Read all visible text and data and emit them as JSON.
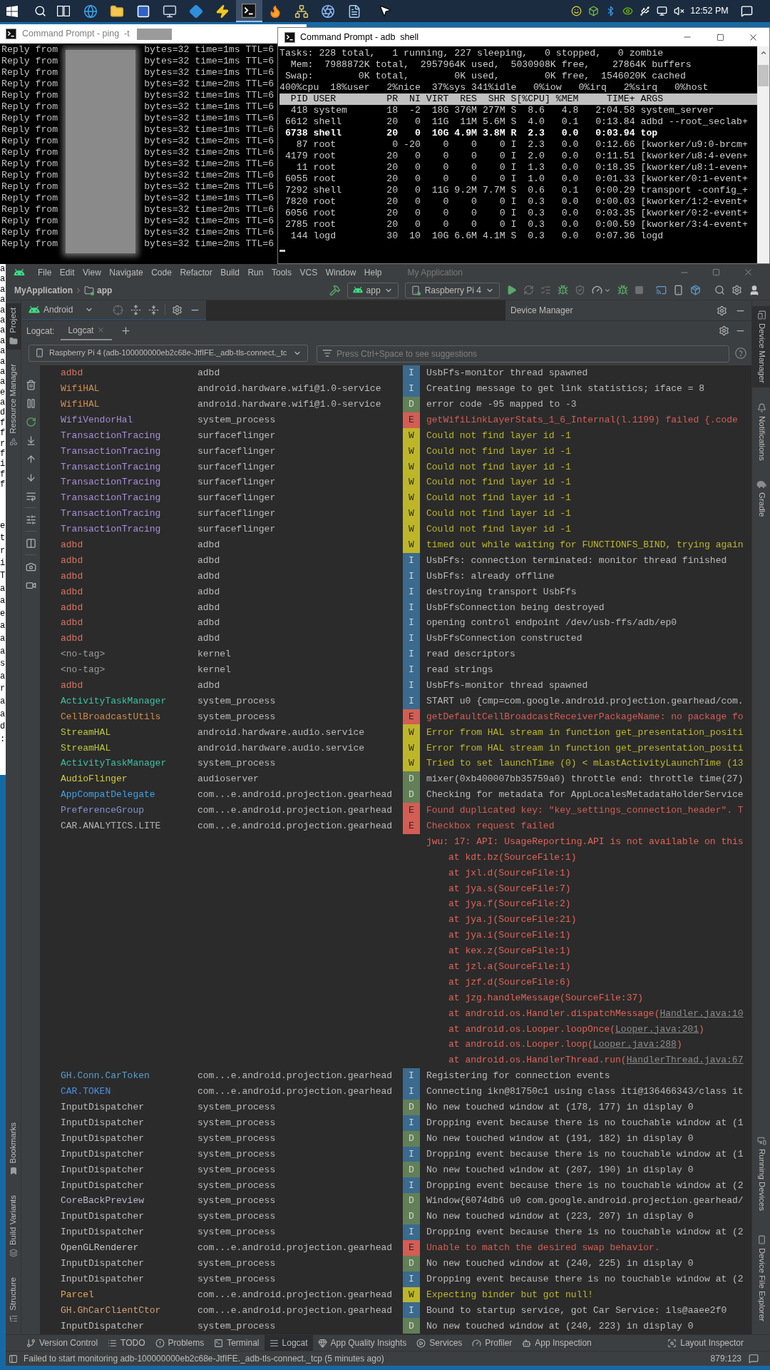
{
  "taskbar": {
    "apps": [
      {
        "selected": false
      },
      {
        "selected": false
      },
      {
        "selected": false
      },
      {
        "selected": false
      },
      {
        "selected": false
      },
      {
        "selected": false
      },
      {
        "selected": true
      },
      {
        "selected": false
      },
      {
        "selected": false
      },
      {
        "selected": false
      },
      {
        "selected": false
      }
    ],
    "clock": "12:52 PM"
  },
  "background_window": {
    "upper_lines": [
      "a",
      "a",
      "a",
      "a",
      "a",
      "a",
      "a",
      "a",
      "a",
      "a",
      "a",
      "a",
      "e",
      "a",
      "d",
      "f",
      "f",
      "r",
      "f",
      "i",
      "f",
      "f"
    ],
    "lower_lines": [
      "e",
      "t",
      "r",
      "i",
      "T",
      "a",
      "a",
      "e",
      "a",
      "a",
      "a",
      "s",
      "a",
      "r",
      "a",
      "a",
      "d",
      ":"
    ]
  },
  "ping_window": {
    "title": "Command Prompt - ping  -t",
    "lines": [
      {
        "start": "Reply from",
        "reply": "bytes=32 time=1ms TTL=6"
      },
      {
        "start": "Reply from",
        "reply": "bytes=32 time=1ms TTL=6"
      },
      {
        "start": "Reply from",
        "reply": "bytes=32 time=1ms TTL=6"
      },
      {
        "start": "Reply from",
        "reply": "bytes=32 time=2ms TTL=6"
      },
      {
        "start": "Reply from",
        "reply": "bytes=32 time=1ms TTL=6"
      },
      {
        "start": "Reply from",
        "reply": "bytes=32 time=1ms TTL=6"
      },
      {
        "start": "Reply from",
        "reply": "bytes=32 time=1ms TTL=6"
      },
      {
        "start": "Reply from",
        "reply": "bytes=32 time=1ms TTL=6"
      },
      {
        "start": "Reply from",
        "reply": "bytes=32 time=2ms TTL=6"
      },
      {
        "start": "Reply from",
        "reply": "bytes=32 time=2ms TTL=6"
      },
      {
        "start": "Reply from",
        "reply": "bytes=32 time=2ms TTL=6"
      },
      {
        "start": "Reply from",
        "reply": "bytes=32 time=2ms TTL=6"
      },
      {
        "start": "Reply from",
        "reply": "bytes=32 time=2ms TTL=6"
      },
      {
        "start": "Reply from",
        "reply": "bytes=32 time=1ms TTL=6"
      },
      {
        "start": "Reply from",
        "reply": "bytes=32 time=2ms TTL=6"
      },
      {
        "start": "Reply from",
        "reply": "bytes=32 time=2ms TTL=6"
      },
      {
        "start": "Reply from",
        "reply": "bytes=32 time=2ms TTL=6"
      },
      {
        "start": "Reply from",
        "reply": "bytes=32 time=2ms TTL=6"
      }
    ]
  },
  "adb_window": {
    "title": "Command Prompt - adb  shell",
    "summary_lines": [
      "Tasks: 228 total,   1 running, 227 sleeping,   0 stopped,   0 zombie",
      "  Mem:  7988872K total,  2957964K used,  5030908K free,    27864K buffers",
      " Swap:        0K total,        0K used,        0K free,  1546020K cached",
      "400%cpu  18%user   2%nice  37%sys 341%idle   0%iow   0%irq   2%sirq   0%host"
    ],
    "table_header": "  PID USER         PR  NI VIRT  RES  SHR S[%CPU] %MEM     TIME+ ARGS",
    "process_rows": [
      {
        "text": "  418 system       18  -2  18G 376M 277M S  8.6   4.8   2:04.58 system_server",
        "bold": false
      },
      {
        "text": " 6612 shell        20   0  11G  11M 5.6M S  4.0   0.1   0:13.84 adbd --root_seclab+",
        "bold": false
      },
      {
        "text": " 6738 shell        20   0  10G 4.9M 3.8M R  2.3   0.0   0:03.94 top",
        "bold": true
      },
      {
        "text": "   87 root          0 -20    0    0    0 I  2.3   0.0   0:12.66 [kworker/u9:0-brcm+",
        "bold": false
      },
      {
        "text": " 4179 root         20   0    0    0    0 I  2.0   0.0   0:11.51 [kworker/u8:4-even+",
        "bold": false
      },
      {
        "text": "   11 root         20   0    0    0    0 I  1.3   0.0   0:18.35 [kworker/u8:1-even+",
        "bold": false
      },
      {
        "text": " 6055 root         20   0    0    0    0 I  1.0   0.0   0:01.33 [kworker/0:1-event+",
        "bold": false
      },
      {
        "text": " 7292 shell        20   0  11G 9.2M 7.7M S  0.6   0.1   0:00.29 transport -config_+",
        "bold": false
      },
      {
        "text": " 7820 root         20   0    0    0    0 I  0.3   0.0   0:00.03 [kworker/1:2-event+",
        "bold": false
      },
      {
        "text": " 6056 root         20   0    0    0    0 I  0.3   0.0   0:03.35 [kworker/0:2-event+",
        "bold": false
      },
      {
        "text": " 2785 root         20   0    0    0    0 I  0.3   0.0   0:00.59 [kworker/3:4-event+",
        "bold": false
      },
      {
        "text": "  144 logd         30  10  10G 6.6M 4.1M S  0.3   0.0   0:07.36 logd",
        "bold": false
      }
    ]
  },
  "android_studio": {
    "menu": [
      "File",
      "Edit",
      "View",
      "Navigate",
      "Code",
      "Refactor",
      "Build",
      "Run",
      "Tools",
      "VCS",
      "Window",
      "Help"
    ],
    "title": "My Application",
    "breadcrumb": [
      "MyApplication",
      "app"
    ],
    "run_configuration": "app",
    "target_device": "Raspberry Pi 4",
    "left_tool_tabs": {
      "top": [
        {
          "label": "Project",
          "selected": true
        },
        {
          "label": "Resource Manager",
          "selected": false
        }
      ],
      "bottom": [
        {
          "label": "Bookmarks",
          "selected": false
        },
        {
          "label": "Build Variants",
          "selected": false
        },
        {
          "label": "Structure",
          "selected": false
        }
      ]
    },
    "right_tool_tabs": {
      "top": [
        {
          "label": "Device Manager",
          "selected": true
        },
        {
          "label": "Notifications",
          "selected": false
        },
        {
          "label": "Gradle",
          "selected": false
        }
      ],
      "bottom": [
        {
          "label": "Running Devices",
          "selected": false
        },
        {
          "label": "Device File Explorer",
          "selected": false
        }
      ]
    },
    "project_panel": {
      "view": "Android"
    },
    "device_manager_panel": {
      "title": "Device Manager"
    },
    "logcat": {
      "label": "Logcat:",
      "tabs": [
        {
          "label": "Logcat",
          "selected": true
        }
      ],
      "device": "Raspberry Pi 4 (adb-100000000eb2c68e-JtfIFE._adb-tls-connect._tc",
      "filter": {
        "placeholder": "Press Ctrl+Space to see suggestions"
      },
      "rows": [
        {
          "kind": "entry",
          "tag": {
            "text": "adbd",
            "color": "#d9725f"
          },
          "process": "adbd",
          "level": {
            "text": "I",
            "color": "#3a6a8e"
          },
          "message": "UsbFfs-monitor thread spawned"
        },
        {
          "kind": "entry",
          "tag": {
            "text": "WifiHAL",
            "color": "#d48d4e"
          },
          "process": "android.hardware.wifi@1.0-service",
          "level": {
            "text": "I",
            "color": "#3a6a8e"
          },
          "message": "Creating message to get link statistics; iface = 8"
        },
        {
          "kind": "entry",
          "tag": {
            "text": "WifiHAL",
            "color": "#d48d4e"
          },
          "process": "android.hardware.wifi@1.0-service",
          "level": {
            "text": "D",
            "color": "#627f57"
          },
          "message": "error code -95 mapped to -3"
        },
        {
          "kind": "entry",
          "tag": {
            "text": "WifiVendorHal",
            "color": "#a08ed4"
          },
          "process": "system_process",
          "level": {
            "text": "E",
            "color": "#d45d54"
          },
          "message": "getWifiLinkLayerStats_1_6_Internal(l.1199) failed {.code"
        },
        {
          "kind": "entry",
          "tag": {
            "text": "TransactionTracing",
            "color": "#a78fd9"
          },
          "process": "surfaceflinger",
          "level": {
            "text": "W",
            "color": "#bdb629"
          },
          "message": "Could not find layer id -1"
        },
        {
          "kind": "entry",
          "tag": {
            "text": "TransactionTracing",
            "color": "#a78fd9"
          },
          "process": "surfaceflinger",
          "level": {
            "text": "W",
            "color": "#bdb629"
          },
          "message": "Could not find layer id -1"
        },
        {
          "kind": "entry",
          "tag": {
            "text": "TransactionTracing",
            "color": "#a78fd9"
          },
          "process": "surfaceflinger",
          "level": {
            "text": "W",
            "color": "#bdb629"
          },
          "message": "Could not find layer id -1"
        },
        {
          "kind": "entry",
          "tag": {
            "text": "TransactionTracing",
            "color": "#a78fd9"
          },
          "process": "surfaceflinger",
          "level": {
            "text": "W",
            "color": "#bdb629"
          },
          "message": "Could not find layer id -1"
        },
        {
          "kind": "entry",
          "tag": {
            "text": "TransactionTracing",
            "color": "#a78fd9"
          },
          "process": "surfaceflinger",
          "level": {
            "text": "W",
            "color": "#bdb629"
          },
          "message": "Could not find layer id -1"
        },
        {
          "kind": "entry",
          "tag": {
            "text": "TransactionTracing",
            "color": "#a78fd9"
          },
          "process": "surfaceflinger",
          "level": {
            "text": "W",
            "color": "#bdb629"
          },
          "message": "Could not find layer id -1"
        },
        {
          "kind": "entry",
          "tag": {
            "text": "TransactionTracing",
            "color": "#a78fd9"
          },
          "process": "surfaceflinger",
          "level": {
            "text": "W",
            "color": "#bdb629"
          },
          "message": "Could not find layer id -1"
        },
        {
          "kind": "entry",
          "tag": {
            "text": "adbd",
            "color": "#d9725f"
          },
          "process": "adbd",
          "level": {
            "text": "W",
            "color": "#bdb629"
          },
          "message": "timed out while waiting for FUNCTIONFS_BIND, trying again"
        },
        {
          "kind": "entry",
          "tag": {
            "text": "adbd",
            "color": "#d9725f"
          },
          "process": "adbd",
          "level": {
            "text": "I",
            "color": "#3a6a8e"
          },
          "message": "UsbFfs: connection terminated: monitor thread finished"
        },
        {
          "kind": "entry",
          "tag": {
            "text": "adbd",
            "color": "#d9725f"
          },
          "process": "adbd",
          "level": {
            "text": "I",
            "color": "#3a6a8e"
          },
          "message": "UsbFfs: already offline"
        },
        {
          "kind": "entry",
          "tag": {
            "text": "adbd",
            "color": "#d9725f"
          },
          "process": "adbd",
          "level": {
            "text": "I",
            "color": "#3a6a8e"
          },
          "message": "destroying transport UsbFfs"
        },
        {
          "kind": "entry",
          "tag": {
            "text": "adbd",
            "color": "#d9725f"
          },
          "process": "adbd",
          "level": {
            "text": "I",
            "color": "#3a6a8e"
          },
          "message": "UsbFfsConnection being destroyed"
        },
        {
          "kind": "entry",
          "tag": {
            "text": "adbd",
            "color": "#d9725f"
          },
          "process": "adbd",
          "level": {
            "text": "I",
            "color": "#3a6a8e"
          },
          "message": "opening control endpoint /dev/usb-ffs/adb/ep0"
        },
        {
          "kind": "entry",
          "tag": {
            "text": "adbd",
            "color": "#d9725f"
          },
          "process": "adbd",
          "level": {
            "text": "I",
            "color": "#3a6a8e"
          },
          "message": "UsbFfsConnection constructed"
        },
        {
          "kind": "entry",
          "tag": {
            "text": "<no-tag>",
            "color": "#9b9b9b"
          },
          "process": "kernel",
          "level": {
            "text": "I",
            "color": "#3a6a8e"
          },
          "message": "read descriptors"
        },
        {
          "kind": "entry",
          "tag": {
            "text": "<no-tag>",
            "color": "#9b9b9b"
          },
          "process": "kernel",
          "level": {
            "text": "I",
            "color": "#3a6a8e"
          },
          "message": "read strings"
        },
        {
          "kind": "entry",
          "tag": {
            "text": "adbd",
            "color": "#d9725f"
          },
          "process": "adbd",
          "level": {
            "text": "I",
            "color": "#3a6a8e"
          },
          "message": "UsbFfs-monitor thread spawned"
        },
        {
          "kind": "entry",
          "tag": {
            "text": "ActivityTaskManager",
            "color": "#3cc0a4"
          },
          "process": "system_process",
          "level": {
            "text": "I",
            "color": "#3a6a8e"
          },
          "message": "START u0 {cmp=com.google.android.projection.gearhead/com."
        },
        {
          "kind": "entry",
          "tag": {
            "text": "CellBroadcastUtils",
            "color": "#d08c48"
          },
          "process": "system_process",
          "level": {
            "text": "E",
            "color": "#d45d54"
          },
          "message": "getDefaultCellBroadcastReceiverPackageName: no package fo"
        },
        {
          "kind": "entry",
          "tag": {
            "text": "StreamHAL",
            "color": "#b7ca35"
          },
          "process": "android.hardware.audio.service",
          "level": {
            "text": "W",
            "color": "#bdb629"
          },
          "message": "Error from HAL stream in function get_presentation_positi"
        },
        {
          "kind": "entry",
          "tag": {
            "text": "StreamHAL",
            "color": "#b7ca35"
          },
          "process": "android.hardware.audio.service",
          "level": {
            "text": "W",
            "color": "#bdb629"
          },
          "message": "Error from HAL stream in function get_presentation_positi"
        },
        {
          "kind": "entry",
          "tag": {
            "text": "ActivityTaskManager",
            "color": "#3cc0a4"
          },
          "process": "system_process",
          "level": {
            "text": "W",
            "color": "#bdb629"
          },
          "message": "Tried to set launchTime (0) < mLastActivityLaunchTime (13"
        },
        {
          "kind": "entry",
          "tag": {
            "text": "AudioFlinger",
            "color": "#cfcc3e"
          },
          "process": "audioserver",
          "level": {
            "text": "D",
            "color": "#627f57"
          },
          "message": "mixer(0xb400007bb35759a0) throttle end: throttle time(27)"
        },
        {
          "kind": "entry",
          "tag": {
            "text": "AppCompatDelegate",
            "color": "#3fa2ea"
          },
          "process": "com...e.android.projection.gearhead",
          "level": {
            "text": "D",
            "color": "#627f57"
          },
          "message": "Checking for metadata for AppLocalesMetadataHolderService"
        },
        {
          "kind": "entry",
          "tag": {
            "text": "PreferenceGroup",
            "color": "#8592d4"
          },
          "process": "com...e.android.projection.gearhead",
          "level": {
            "text": "E",
            "color": "#d45d54"
          },
          "message": "Found duplicated key: \"key_settings_connection_header\". T"
        },
        {
          "kind": "entry",
          "tag": {
            "text": "CAR.ANALYTICS.LITE",
            "color": "#b3b3b3"
          },
          "process": "com...e.android.projection.gearhead",
          "level": {
            "text": "E",
            "color": "#d45d54"
          },
          "message": "Checkbox request failed"
        },
        {
          "kind": "detail",
          "text": "jwu: 17: API: UsageReporting.API is not available on this"
        },
        {
          "kind": "frame",
          "text": "at kdt.bz(SourceFile:1)"
        },
        {
          "kind": "frame",
          "text": "at jxl.d(SourceFile:1)"
        },
        {
          "kind": "frame",
          "text": "at jya.s(SourceFile:7)"
        },
        {
          "kind": "frame",
          "text": "at jya.f(SourceFile:2)"
        },
        {
          "kind": "frame",
          "text": "at jya.j(SourceFile:21)"
        },
        {
          "kind": "frame",
          "text": "at jya.i(SourceFile:1)"
        },
        {
          "kind": "frame",
          "text": "at kex.z(SourceFile:1)"
        },
        {
          "kind": "frame",
          "text": "at jzl.a(SourceFile:1)"
        },
        {
          "kind": "frame",
          "text": "at jzf.d(SourceFile:6)"
        },
        {
          "kind": "frame",
          "text": "at jzg.handleMessage(SourceFile:37)"
        },
        {
          "kind": "frame",
          "text": "at android.os.Handler.dispatchMessage(",
          "link": "Handler.java:10"
        },
        {
          "kind": "frame",
          "text": "at android.os.Looper.loopOnce(",
          "link": "Looper.java:201",
          "suffix": ")"
        },
        {
          "kind": "frame",
          "text": "at android.os.Looper.loop(",
          "link": "Looper.java:288",
          "suffix": ")"
        },
        {
          "kind": "frame",
          "text": "at android.os.HandlerThread.run(",
          "link": "HandlerThread.java:67"
        },
        {
          "kind": "entry",
          "tag": {
            "text": "GH.Conn.CarToken",
            "color": "#5a9fc9"
          },
          "process": "com...e.android.projection.gearhead",
          "level": {
            "text": "I",
            "color": "#3a6a8e"
          },
          "message": "Registering for connection events"
        },
        {
          "kind": "entry",
          "tag": {
            "text": "CAR.TOKEN",
            "color": "#4b91e3"
          },
          "process": "com...e.android.projection.gearhead",
          "level": {
            "text": "I",
            "color": "#3a6a8e"
          },
          "message": "Connecting ikn@81750c1 using class iti@136466343/class it"
        },
        {
          "kind": "entry",
          "tag": {
            "text": "InputDispatcher",
            "color": "#bcbcbc"
          },
          "process": "system_process",
          "level": {
            "text": "D",
            "color": "#627f57"
          },
          "message": "No new touched window at (178, 177) in display 0"
        },
        {
          "kind": "entry",
          "tag": {
            "text": "InputDispatcher",
            "color": "#bcbcbc"
          },
          "process": "system_process",
          "level": {
            "text": "I",
            "color": "#3a6a8e"
          },
          "message": "Dropping event because there is no touchable window at (1"
        },
        {
          "kind": "entry",
          "tag": {
            "text": "InputDispatcher",
            "color": "#bcbcbc"
          },
          "process": "system_process",
          "level": {
            "text": "D",
            "color": "#627f57"
          },
          "message": "No new touched window at (191, 182) in display 0"
        },
        {
          "kind": "entry",
          "tag": {
            "text": "InputDispatcher",
            "color": "#bcbcbc"
          },
          "process": "system_process",
          "level": {
            "text": "I",
            "color": "#3a6a8e"
          },
          "message": "Dropping event because there is no touchable window at (1"
        },
        {
          "kind": "entry",
          "tag": {
            "text": "InputDispatcher",
            "color": "#bcbcbc"
          },
          "process": "system_process",
          "level": {
            "text": "D",
            "color": "#627f57"
          },
          "message": "No new touched window at (207, 190) in display 0"
        },
        {
          "kind": "entry",
          "tag": {
            "text": "InputDispatcher",
            "color": "#bcbcbc"
          },
          "process": "system_process",
          "level": {
            "text": "I",
            "color": "#3a6a8e"
          },
          "message": "Dropping event because there is no touchable window at (2"
        },
        {
          "kind": "entry",
          "tag": {
            "text": "CoreBackPreview",
            "color": "#b7b9cd"
          },
          "process": "system_process",
          "level": {
            "text": "D",
            "color": "#627f57"
          },
          "message": "Window{6074db6 u0 com.google.android.projection.gearhead/"
        },
        {
          "kind": "entry",
          "tag": {
            "text": "InputDispatcher",
            "color": "#bcbcbc"
          },
          "process": "system_process",
          "level": {
            "text": "D",
            "color": "#627f57"
          },
          "message": "No new touched window at (223, 207) in display 0"
        },
        {
          "kind": "entry",
          "tag": {
            "text": "InputDispatcher",
            "color": "#bcbcbc"
          },
          "process": "system_process",
          "level": {
            "text": "I",
            "color": "#3a6a8e"
          },
          "message": "Dropping event because there is no touchable window at (2"
        },
        {
          "kind": "entry",
          "tag": {
            "text": "OpenGLRenderer",
            "color": "#c6c6c6"
          },
          "process": "com...e.android.projection.gearhead",
          "level": {
            "text": "E",
            "color": "#d45d54"
          },
          "message": "Unable to match the desired swap behavior."
        },
        {
          "kind": "entry",
          "tag": {
            "text": "InputDispatcher",
            "color": "#bcbcbc"
          },
          "process": "system_process",
          "level": {
            "text": "D",
            "color": "#627f57"
          },
          "message": "No new touched window at (240, 225) in display 0"
        },
        {
          "kind": "entry",
          "tag": {
            "text": "InputDispatcher",
            "color": "#bcbcbc"
          },
          "process": "system_process",
          "level": {
            "text": "I",
            "color": "#3a6a8e"
          },
          "message": "Dropping event because there is no touchable window at (2"
        },
        {
          "kind": "entry",
          "tag": {
            "text": "Parcel",
            "color": "#e9a44e"
          },
          "process": "com...e.android.projection.gearhead",
          "level": {
            "text": "W",
            "color": "#bdb629"
          },
          "message": "Expecting binder but got null!"
        },
        {
          "kind": "entry",
          "tag": {
            "text": "GH.GhCarClientCtor",
            "color": "#d69f70"
          },
          "process": "com...e.android.projection.gearhead",
          "level": {
            "text": "I",
            "color": "#3a6a8e"
          },
          "message": "Bound to startup service, got Car Service: ils@aaee2f0"
        },
        {
          "kind": "entry",
          "tag": {
            "text": "InputDispatcher",
            "color": "#bcbcbc"
          },
          "process": "system_process",
          "level": {
            "text": "D",
            "color": "#627f57"
          },
          "message": "No new touched window at (240, 223) in display 0"
        }
      ]
    },
    "bottom_tabs": {
      "left": [
        {
          "label": "Version Control",
          "selected": false
        },
        {
          "label": "TODO",
          "selected": false
        },
        {
          "label": "Problems",
          "selected": false
        },
        {
          "label": "Terminal",
          "selected": false
        },
        {
          "label": "Logcat",
          "selected": true
        },
        {
          "label": "App Quality Insights",
          "selected": false
        },
        {
          "label": "Services",
          "selected": false
        },
        {
          "label": "Profiler",
          "selected": false
        },
        {
          "label": "App Inspection",
          "selected": false
        }
      ],
      "right": [
        {
          "label": "Layout Inspector",
          "selected": false
        }
      ]
    },
    "status_bar": {
      "message": "Failed to start monitoring adb-100000000eb2c68e-JtfIFE._adb-tls-connect._tcp (5 minutes ago)",
      "position": "879:123"
    }
  }
}
